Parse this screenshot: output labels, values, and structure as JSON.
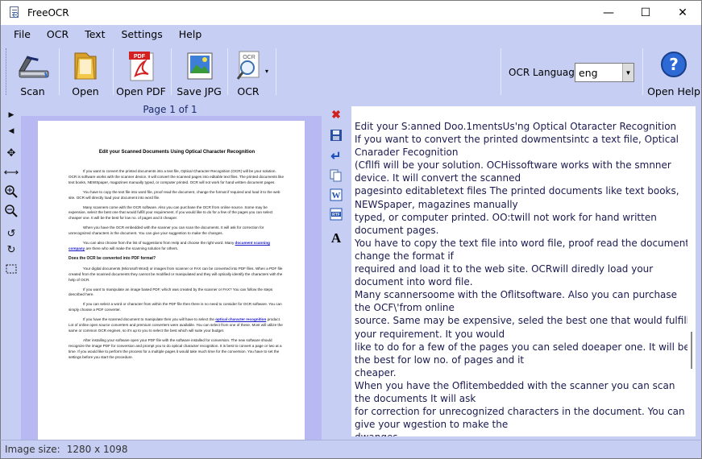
{
  "window": {
    "title": "FreeOCR",
    "minimize_glyph": "—",
    "maximize_glyph": "☐",
    "close_glyph": "✕"
  },
  "menu": [
    "File",
    "OCR",
    "Text",
    "Settings",
    "Help"
  ],
  "toolbar": {
    "scan_label": "Scan",
    "open_label": "Open",
    "open_pdf_label": "Open PDF",
    "save_jpg_label": "Save JPG",
    "ocr_label": "OCR",
    "ocr_language_label": "OCR Language:",
    "ocr_language_value": "eng",
    "open_help_label": "Open Help",
    "icon_pdf_text": "PDF",
    "icon_ocr_text": "OCR"
  },
  "image_panel": {
    "page_label": "Page 1 of 1",
    "document": {
      "title": "Edit your Scanned Documents Using Optical Character Recognition",
      "p1": "If you want to convert the printed documents into a text file, Optical Character Recognition (OCR) will be your solution. OCR is software works with the scanner device. It will convert the scanned pages into editable text files. The printed documents like text books, NEWSpaper, magazines manually typed, or computer printed. OCR will not work for hand written document pages.",
      "p2": "You have to copy the text file into word file, proof read the document, change the format if required and load it to the web site. OCR will directly load your document into word file.",
      "p3": "Many scanners come with the OCR software. Also you can purchase the OCR from online source. Some may be expensive, select the best one that would fulfill your requirement. If you would like to do for a few of the pages you can select cheaper one. It will be the best for low no. of pages and it cheaper.",
      "p4": "When you have the OCR embedded with the scanner you can scan the documents. It will ask for correction for unrecognized characters in the document. You can give your suggestion to make the changes.",
      "p5_pre": "You can also choose from the list of suggestions from Help and choose the right word. Many",
      "p5_link": "document scanning company",
      "p5_post": "are there who will make the scanning solution for others.",
      "h1": "Does the OCR be converted into PDF format?",
      "p6": "Your digital documents (Microsoft Word) or images from scanner or FAX can be converted into PDF files. When a PDF file created from the scanned documents they cannot be modified or manipulated and they will optically identify the characters with the help of OCR.",
      "p7": "If you want to manipulate an image based PDF, which was created by the scanner or FAX? You can follow the steps described here.",
      "p8": "If you can select a word or character from within the PDF file then there is no need to consider for OCR software. You can simply choose a PDF converter.",
      "p9_pre": "If you have the scanned document to manipulate then you will have to select the",
      "p9_link": "optical character recognition",
      "p9_post": "product. Lot of online open source converters and premium converters were available. You can select from one of these. Most will utilize the same or common OCR engines, so it's up to you to select the best which will suite your budget.",
      "p10": "After installing your software open your PDF file with the software installed for conversion. The new software should recognize the image PDF for conversion and prompt you to do optical character recognition. It is best to convert a page or two at a time. If you would like to perform the process for a multiple pages it would take much time for the conversion. You have to set the settings before you start the procedure."
    }
  },
  "ocr_text_lines": [
    "Edit your S:anned Doo.1mentsUs'ng Optical Otaracter Recognition",
    "If you want to convert the printed dowmentsintc a text file, Optical",
    "Cnarader Fecognition",
    "(Cfllfi will be your solution. OCHissoftware works with the smnner",
    "device. It will convert the scanned",
    "pagesinto editabletext files The printed documents like text books,",
    "NEWSpaper, magazines manually",
    "typed, or computer printed. OO:twill not work for hand written",
    "document pages.",
    "You have to copy the text file into word file, proof read the document,",
    "change the format if",
    "required and load it to the web site. OCRwill diredly load your",
    "document into word file.",
    "Many scannersoome with the Oflitsoftware. Also you can purchase",
    "the OCF\\'from online",
    "source. Same may be expensive, seled the best one that would fulfill",
    "your requirement. It you would",
    "like to do for a few of the pages you can seled doeaper one. It will be",
    "the best for low no. of pages and it",
    "cheaper.",
    "When you have the Oflitembedded with the scanner you can scan",
    "the documents It will ask",
    "for correction for unrecognized characters in the document. You can",
    "give your wgestion to make the",
    "dwanges"
  ],
  "status": {
    "image_size_label": "Image size:",
    "image_size_value": "1280 x 1098"
  },
  "colors": {
    "chrome": "#c6cff3",
    "page_area": "#b8b8f3",
    "text_color": "#1a1a50"
  }
}
